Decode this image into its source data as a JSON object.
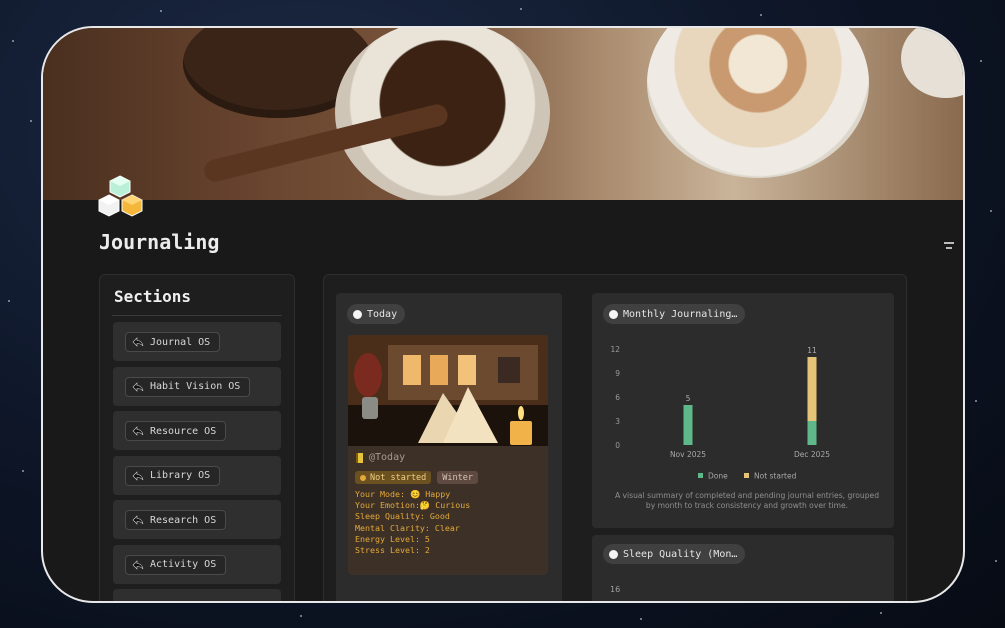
{
  "page": {
    "title": "Journaling",
    "logo_icon": "cube-stack-icon"
  },
  "sections": {
    "title": "Sections",
    "items": [
      {
        "label": "Journal OS",
        "icon": "back-arrow-icon"
      },
      {
        "label": "Habit Vision OS",
        "icon": "back-arrow-icon"
      },
      {
        "label": "Resource OS",
        "icon": "back-arrow-icon"
      },
      {
        "label": "Library OS",
        "icon": "back-arrow-icon"
      },
      {
        "label": "Research OS",
        "icon": "back-arrow-icon"
      },
      {
        "label": "Activity OS",
        "icon": "back-arrow-icon"
      }
    ]
  },
  "today_view": {
    "tab_label": "Today",
    "entry": {
      "title": "@Today",
      "status": "Not started",
      "season": "Winter",
      "properties": [
        "Your Mode: 😊 Happy",
        "Your Emotion:🤔 Curious",
        "Sleep Quality: Good",
        "Mental Clarity: Clear",
        "Energy Level: 5",
        "Stress Level: 2"
      ]
    }
  },
  "monthly_view": {
    "tab_label": "Monthly Journaling…",
    "caption": "A visual summary of completed and pending journal entries, grouped by month to track consistency and growth over time."
  },
  "sleep_view": {
    "tab_label": "Sleep Quality (Mon…",
    "first_tick": "16"
  },
  "colors": {
    "done": "#5fb889",
    "not_started": "#e6c477",
    "status_dot": "#e3a93a"
  },
  "chart_data": {
    "type": "bar",
    "stacked": true,
    "categories": [
      "Nov 2025",
      "Dec 2025"
    ],
    "series": [
      {
        "name": "Done",
        "values": [
          5,
          3
        ]
      },
      {
        "name": "Not started",
        "values": [
          0,
          8
        ]
      }
    ],
    "totals": [
      "5",
      "11"
    ],
    "ylim": [
      0,
      12
    ],
    "yticks": [
      "0",
      "3",
      "6",
      "9",
      "12"
    ],
    "legend_position": "bottom",
    "grid": false
  }
}
